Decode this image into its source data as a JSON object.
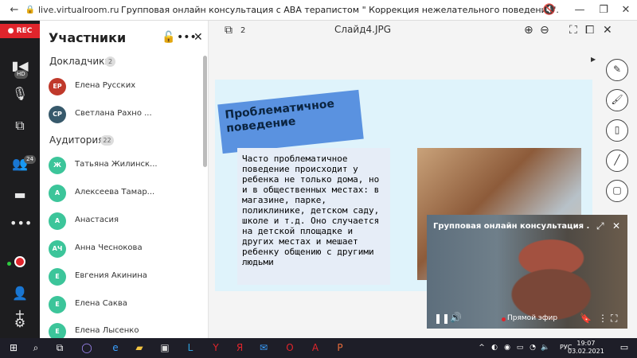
{
  "browser": {
    "url": "live.virtualroom.ru",
    "title": "Групповая онлайн консультация с АВА терапистом \" Коррекция нежелательного поведения\"."
  },
  "rail": {
    "rec_label": "REC",
    "hd_badge": "HD",
    "participants_badge": "24"
  },
  "panel": {
    "title": "Участники",
    "speakers_label": "Докладчики",
    "speakers_count": "2",
    "audience_label": "Аудитория",
    "audience_count": "22",
    "speakers": [
      {
        "initials": "ЕР",
        "name": "Елена Русских",
        "color": "#c0392b"
      },
      {
        "initials": "СР",
        "name": "Светлана Рахно ...",
        "color": "#37596b"
      }
    ],
    "audience": [
      {
        "initials": "Ж",
        "name": "Татьяна Жилинск...",
        "color": "#3cc59a"
      },
      {
        "initials": "А",
        "name": "Алексеева Тамар...",
        "color": "#3cc59a"
      },
      {
        "initials": "А",
        "name": "Анастасия",
        "color": "#3cc59a"
      },
      {
        "initials": "АЧ",
        "name": "Анна Чеснокова",
        "color": "#3cc59a"
      },
      {
        "initials": "Е",
        "name": "Евгения Акинина",
        "color": "#3cc59a"
      },
      {
        "initials": "Е",
        "name": "Елена Саква",
        "color": "#3cc59a"
      },
      {
        "initials": "Е",
        "name": "Елена Лысенко",
        "color": "#3cc59a"
      }
    ]
  },
  "viewer": {
    "slide_count": "2",
    "slide_name": "Слайд4.JPG"
  },
  "slide": {
    "title": "Проблематичное поведение",
    "text": "Часто проблематичное поведение происходит у ребенка не только дома, но и в общественных местах: в магазине, парке, поликлинике, детском саду, школе и т.д. Оно случается на детской площадке и других местах и мешает ребенку общению с другими людьми"
  },
  "video": {
    "title": "Групповая онлайн консультация ...",
    "live_label": "Прямой эфир"
  },
  "taskbar": {
    "lang": "РУС",
    "time": "19:07",
    "date": "03.02.2021"
  }
}
